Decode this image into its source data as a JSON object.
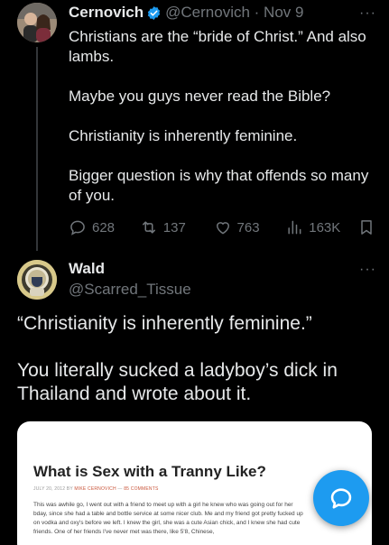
{
  "tweet": {
    "author_name": "Cernovich",
    "handle_date": "@Cernovich · Nov 9",
    "more": "···",
    "paragraphs": [
      "Christians are the “bride of Christ.” And also lambs.",
      "Maybe you guys never read the Bible?",
      "Christianity is inherently feminine.",
      "Bigger question is why that offends so many of you."
    ],
    "actions": {
      "replies": "628",
      "retweets": "137",
      "likes": "763",
      "views": "163K"
    }
  },
  "reply": {
    "author_name": "Wald",
    "handle": "@Scarred_Tissue",
    "more": "···",
    "paragraphs": [
      "“Christianity is inherently feminine.”",
      "You literally sucked a ladyboy’s dick in Thailand and wrote about it."
    ],
    "card": {
      "title": "What is Sex with a Tranny Like?",
      "meta_prefix": "JULY 20, 2012 BY ",
      "meta_author": "MIKE CERNOVICH",
      "meta_sep": " — ",
      "meta_comments": "85 COMMENTS",
      "text": "This was awhile go, I went out with a friend to meet up with a girl he knew who was going out for her bday, since she had a table and bottle service at some nicer club. Me and my friend got pretty fucked up on vodka and oxy's before we left. I knew the girl, she was a cute Asian chick, and I knew she had cute friends. One of her friends I've never met was there, like 5'8, Chinese,"
    }
  },
  "colors": {
    "background": "#000000",
    "text": "#e7e9ea",
    "muted": "#71767b",
    "accent": "#1d9bf0"
  },
  "icons": [
    "verified-badge-icon",
    "more-icon",
    "reply-icon",
    "retweet-icon",
    "like-icon",
    "views-icon",
    "bookmark-icon",
    "compose-fab-icon"
  ]
}
